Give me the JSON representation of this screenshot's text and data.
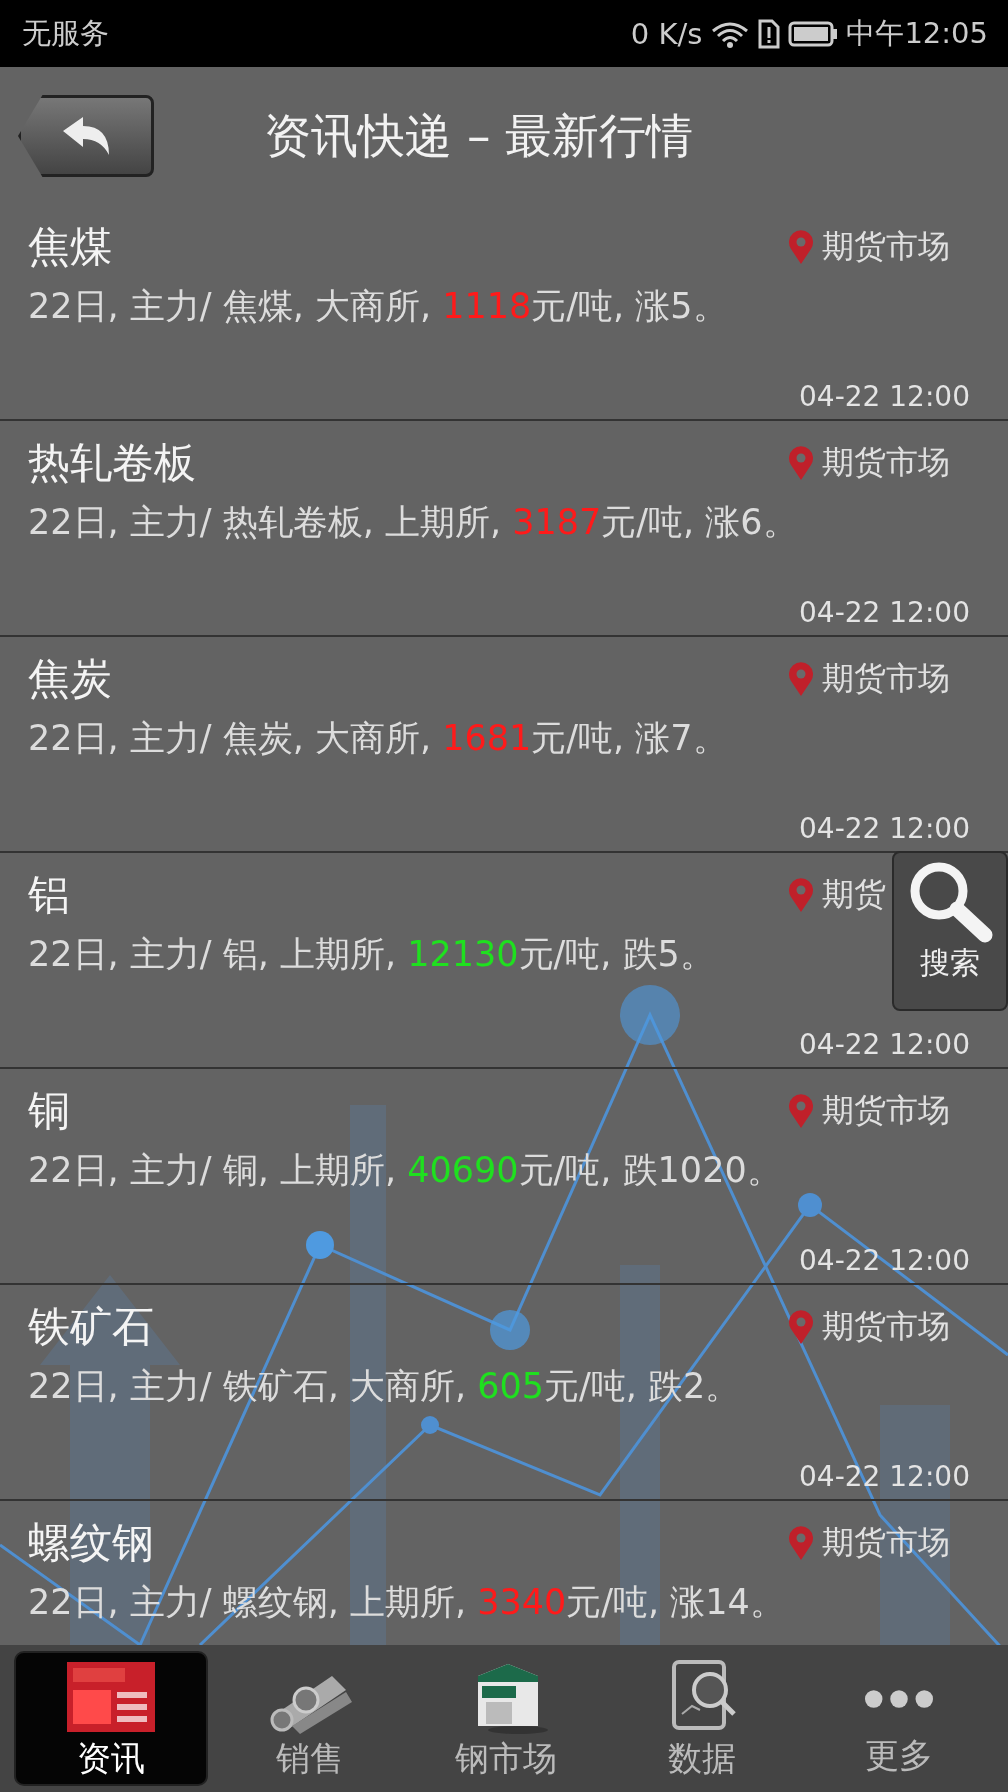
{
  "status_bar": {
    "carrier": "无服务",
    "speed": "0 K/s",
    "time": "中午12:05"
  },
  "header": {
    "title": "资讯快递 – 最新行情"
  },
  "items": [
    {
      "title": "焦煤",
      "before": "22日, 主力/ 焦煤, 大商所, ",
      "price": "1118",
      "after": "元/吨, 涨5。",
      "color": "#ff1a1a",
      "location": "期货市场",
      "time": "04-22 12:00"
    },
    {
      "title": "热轧卷板",
      "before": "22日, 主力/ 热轧卷板, 上期所, ",
      "price": "3187",
      "after": "元/吨, 涨6。",
      "color": "#ff1a1a",
      "location": "期货市场",
      "time": "04-22 12:00"
    },
    {
      "title": "焦炭",
      "before": "22日, 主力/ 焦炭, 大商所, ",
      "price": "1681",
      "after": "元/吨, 涨7。",
      "color": "#ff1a1a",
      "location": "期货市场",
      "time": "04-22 12:00"
    },
    {
      "title": "铝",
      "before": "22日, 主力/ 铝, 上期所, ",
      "price": "12130",
      "after": "元/吨, 跌5。",
      "color": "#1fe01f",
      "location": "期货",
      "time": "04-22 12:00"
    },
    {
      "title": "铜",
      "before": "22日, 主力/ 铜, 上期所, ",
      "price": "40690",
      "after": "元/吨, 跌1020。",
      "color": "#1fe01f",
      "location": "期货市场",
      "time": "04-22 12:00"
    },
    {
      "title": "铁矿石",
      "before": "22日, 主力/ 铁矿石, 大商所, ",
      "price": "605",
      "after": "元/吨, 跌2。",
      "color": "#1fe01f",
      "location": "期货市场",
      "time": "04-22 12:00"
    },
    {
      "title": "螺纹钢",
      "before": "22日, 主力/ 螺纹钢, 上期所, ",
      "price": "3340",
      "after": "元/吨, 涨14。",
      "color": "#ff1a1a",
      "location": "期货市场"
    }
  ],
  "search_button": {
    "label": "搜索"
  },
  "bottom_nav": [
    {
      "label": "资讯",
      "kind": "news",
      "selected": true
    },
    {
      "label": "销售",
      "kind": "pipes",
      "selected": false
    },
    {
      "label": "钢市场",
      "kind": "store",
      "selected": false
    },
    {
      "label": "数据",
      "kind": "data",
      "selected": false
    },
    {
      "label": "更多",
      "kind": "more",
      "selected": false
    }
  ]
}
